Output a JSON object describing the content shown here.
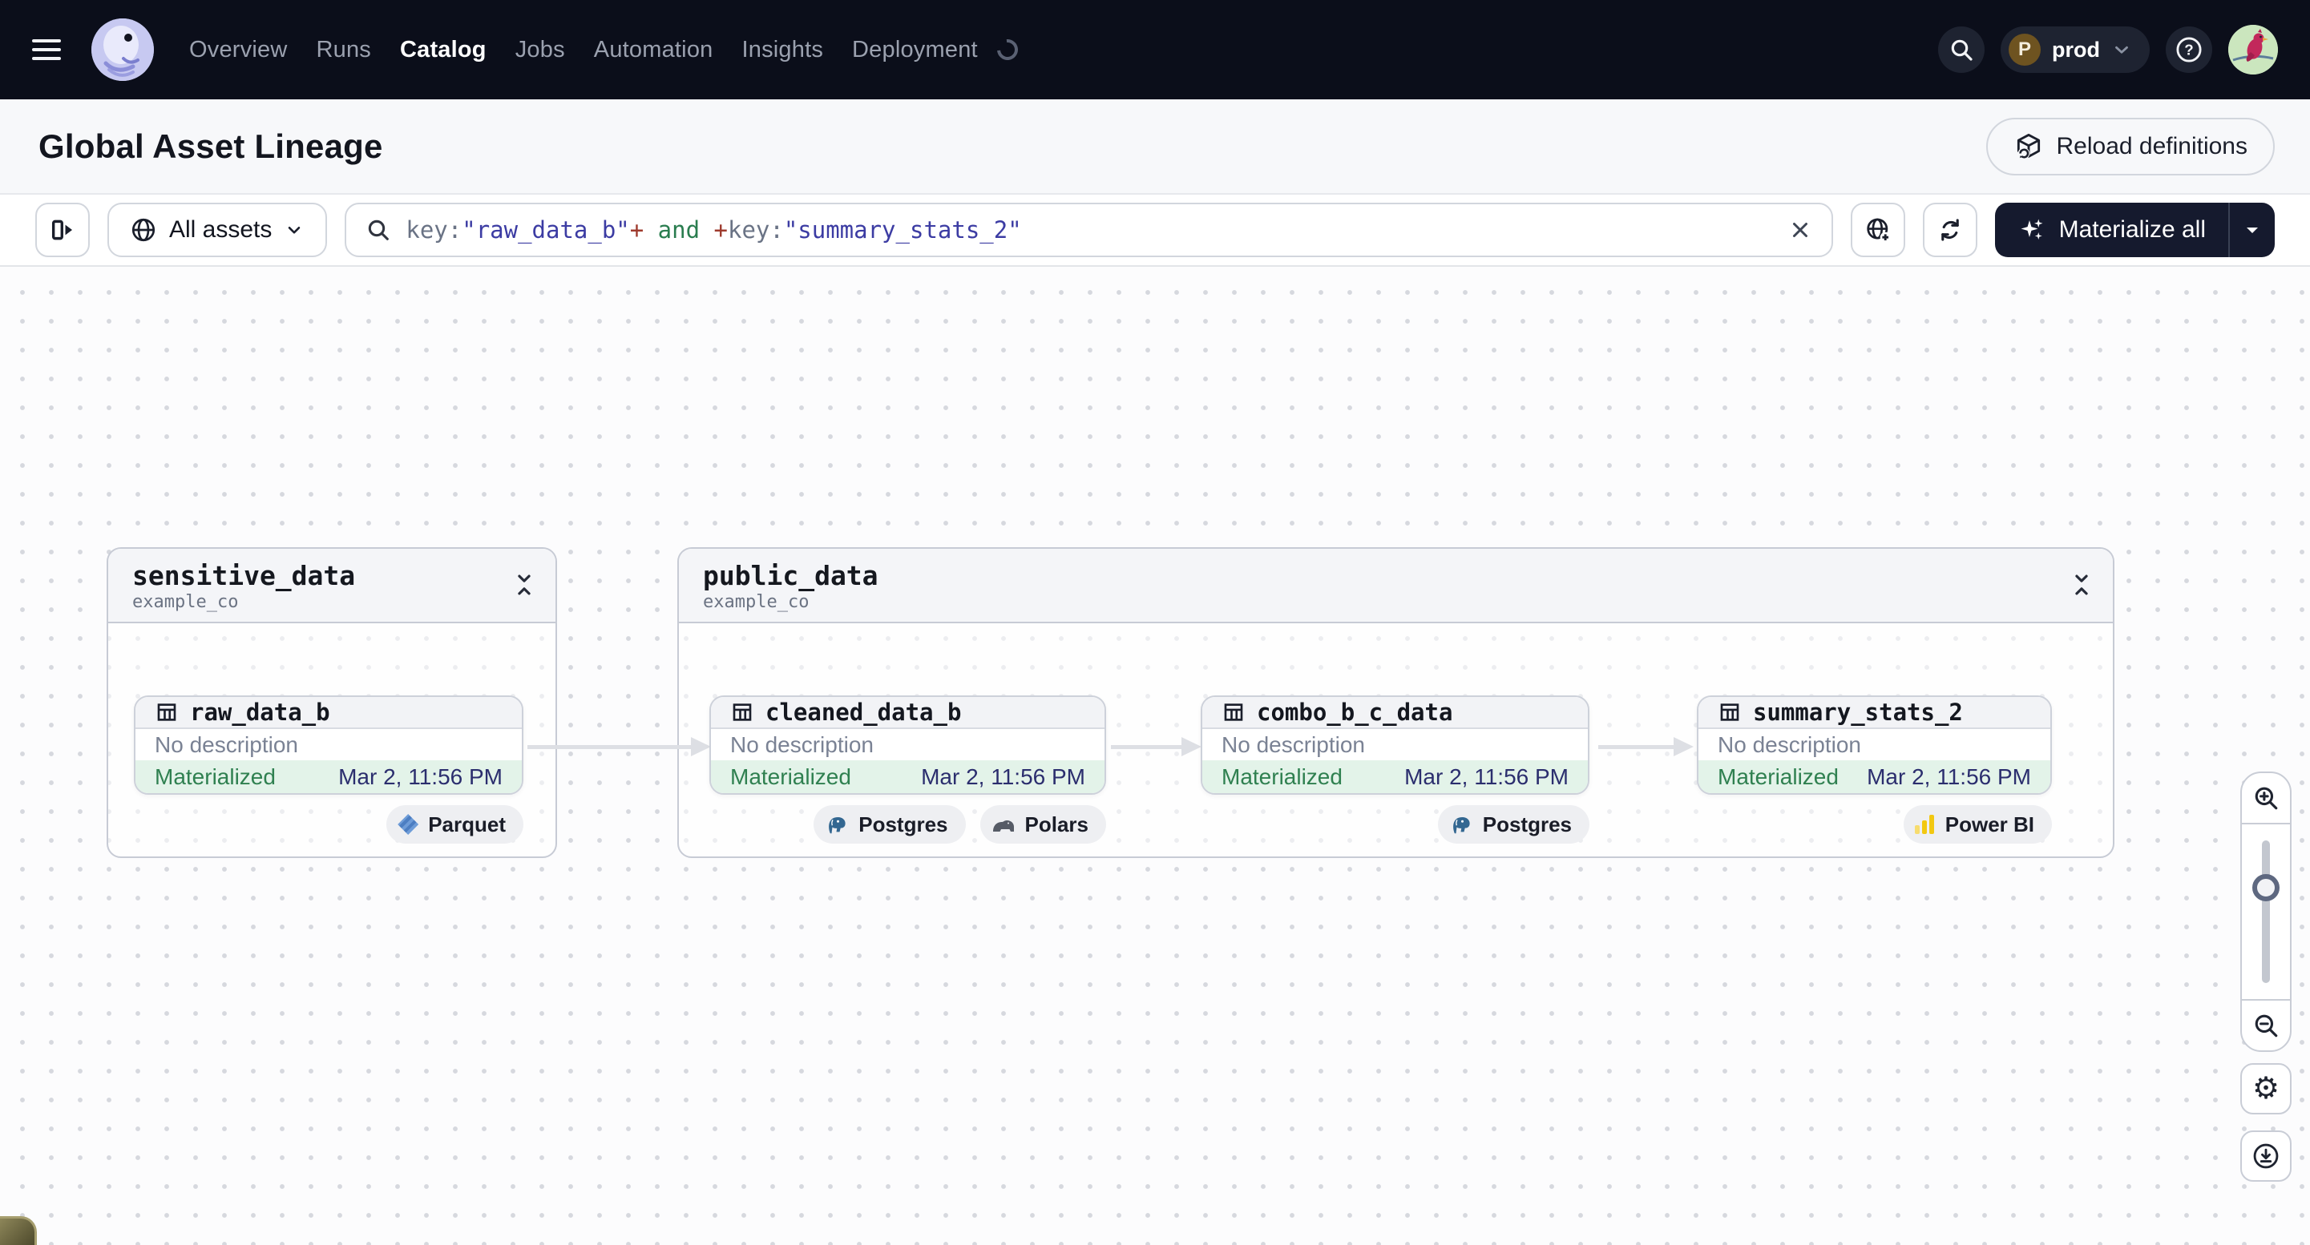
{
  "nav": {
    "items": [
      "Overview",
      "Runs",
      "Catalog",
      "Jobs",
      "Automation",
      "Insights",
      "Deployment"
    ],
    "active_item": "Catalog",
    "deployment": "prod",
    "deployment_initial": "P"
  },
  "header": {
    "title": "Global Asset Lineage",
    "reload_button": "Reload definitions"
  },
  "toolbar": {
    "scope_label": "All assets",
    "materialize_label": "Materialize all",
    "query": {
      "key1": "key:",
      "value1": "\"raw_data_b\"",
      "op1": "+",
      "bool": " and ",
      "op2": "+",
      "key2": "key:",
      "value2": "\"summary_stats_2\""
    }
  },
  "graph": {
    "groups": [
      {
        "title": "sensitive_data",
        "subtitle": "example_co"
      },
      {
        "title": "public_data",
        "subtitle": "example_co"
      }
    ],
    "nodes": [
      {
        "name": "raw_data_b",
        "description": "No description",
        "status": "Materialized",
        "timestamp": "Mar 2, 11:56 PM",
        "tags": [
          {
            "label": "Parquet"
          }
        ]
      },
      {
        "name": "cleaned_data_b",
        "description": "No description",
        "status": "Materialized",
        "timestamp": "Mar 2, 11:56 PM",
        "tags": [
          {
            "label": "Postgres"
          },
          {
            "label": "Polars"
          }
        ]
      },
      {
        "name": "combo_b_c_data",
        "description": "No description",
        "status": "Materialized",
        "timestamp": "Mar 2, 11:56 PM",
        "tags": [
          {
            "label": "Postgres"
          }
        ]
      },
      {
        "name": "summary_stats_2",
        "description": "No description",
        "status": "Materialized",
        "timestamp": "Mar 2, 11:56 PM",
        "tags": [
          {
            "label": "Power BI"
          }
        ]
      }
    ]
  },
  "colors": {
    "nav_bg": "#0B0E1A",
    "dark_button_bg": "#151A2E",
    "status_green_text": "#2F8050",
    "status_green_bg": "#E3F3E9",
    "timestamp_navy": "#2B2E6E",
    "query_string_indigo": "#3C3CA3",
    "query_operator_red": "#9E3A2D",
    "query_bool_green": "#2A7D4F",
    "powerbi_yellow": "#F2C811"
  }
}
